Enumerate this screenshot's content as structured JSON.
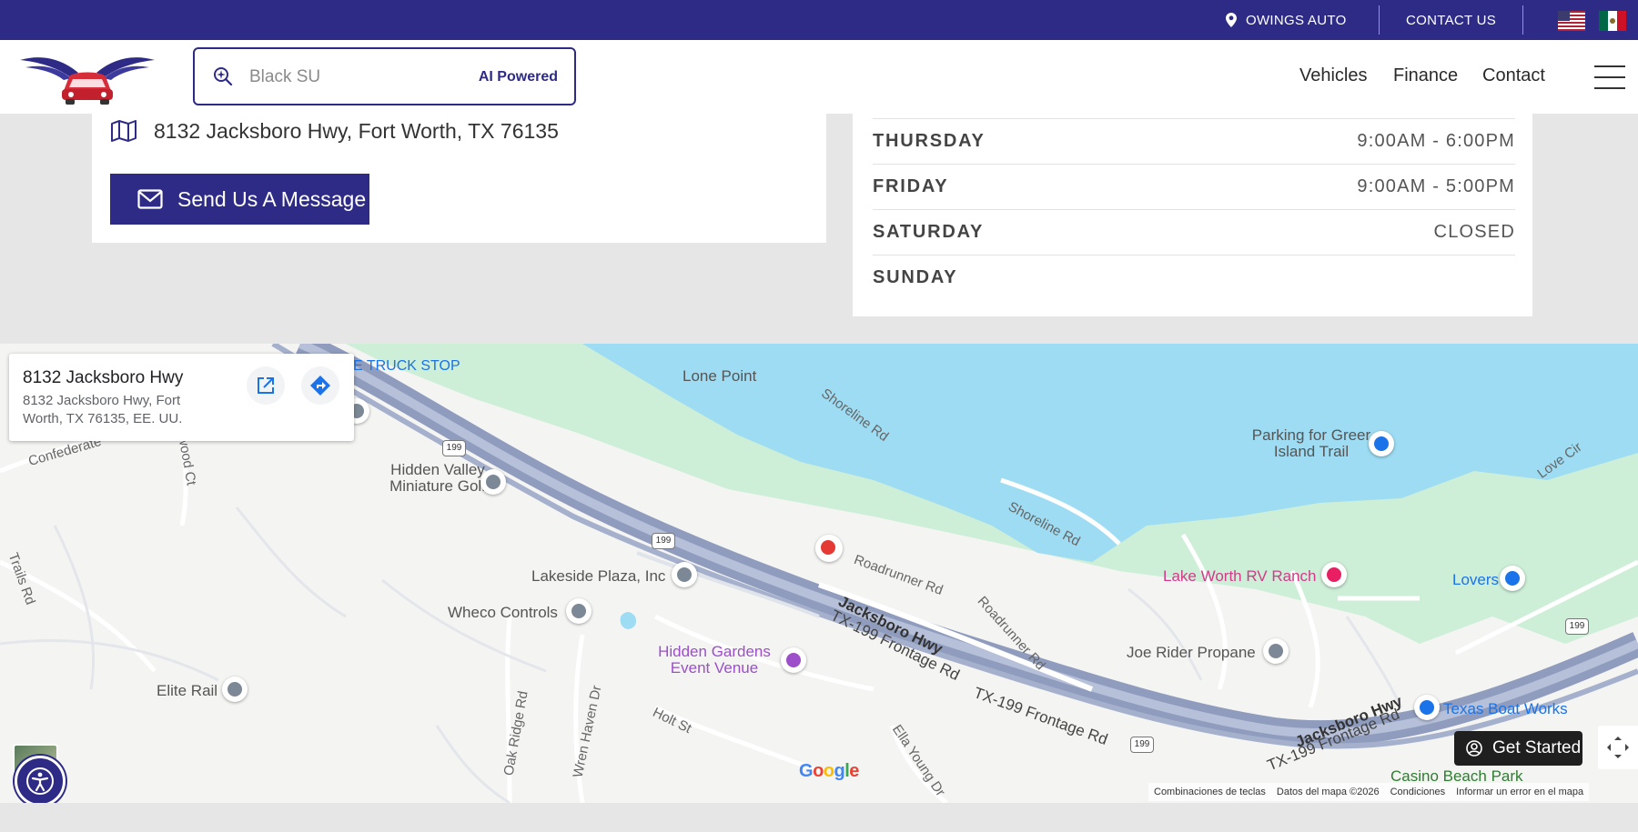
{
  "topbar": {
    "location_label": "OWINGS AUTO",
    "contact_label": "CONTACT US",
    "flags": [
      "us-flag-icon",
      "mx-flag-icon"
    ],
    "bg_color": "#2e2b86"
  },
  "header": {
    "search_placeholder": "Black SU",
    "ai_label": "AI Powered",
    "nav": [
      "Vehicles",
      "Finance",
      "Contact"
    ]
  },
  "contact_card": {
    "address": "8132 Jacksboro Hwy, Fort Worth, TX 76135",
    "message_button": "Send Us A Message"
  },
  "hours": [
    {
      "day": "THURSDAY",
      "time": "9:00AM - 6:00PM"
    },
    {
      "day": "FRIDAY",
      "time": "9:00AM - 5:00PM"
    },
    {
      "day": "SATURDAY",
      "time": "CLOSED"
    },
    {
      "day": "SUNDAY",
      "time": ""
    }
  ],
  "map": {
    "info_title": "8132 Jacksboro Hwy",
    "info_address": "8132 Jacksboro Hwy, Fort Worth, TX 76135, EE. UU.",
    "labels": {
      "truck_stop": "E TRUCK STOP",
      "lone_point": "Lone Point",
      "shoreline_rd": "Shoreline Rd",
      "parking": "Parking for Greer Island Trail",
      "love_cir": "Love Cir",
      "confederate": "Confederate",
      "hidden_valley": "Hidden Valley Miniature Golf",
      "lakeside_plaza": "Lakeside Plaza, Inc",
      "wheco": "Wheco Controls",
      "elite_rail": "Elite Rail",
      "hidden_gardens": "Hidden Gardens Event Venue",
      "holt_st": "Holt St",
      "oak_ridge": "Oak Ridge Rd",
      "wren_haven": "Wren Haven Dr",
      "ella_young": "Ella Young Dr",
      "roadrunner": "Roadrunner Rd",
      "jacksboro": "Jacksboro Hwy",
      "frontage": "TX-199 Frontage Rd",
      "lake_worth_rv": "Lake Worth RV Ranch",
      "lovers": "Lovers",
      "joe_rider": "Joe Rider Propane",
      "texas_boat": "Texas Boat Works",
      "casino_beach": "Casino Beach Park",
      "trails_rd": "Trails Rd",
      "wood_ct": "wood Ct",
      "shield_199": "199"
    },
    "google": "Google",
    "footer": [
      "Combinaciones de teclas",
      "Datos del mapa ©2026",
      "Condiciones",
      "Informar un error en el mapa"
    ]
  },
  "widgets": {
    "get_started": "Get Started"
  }
}
